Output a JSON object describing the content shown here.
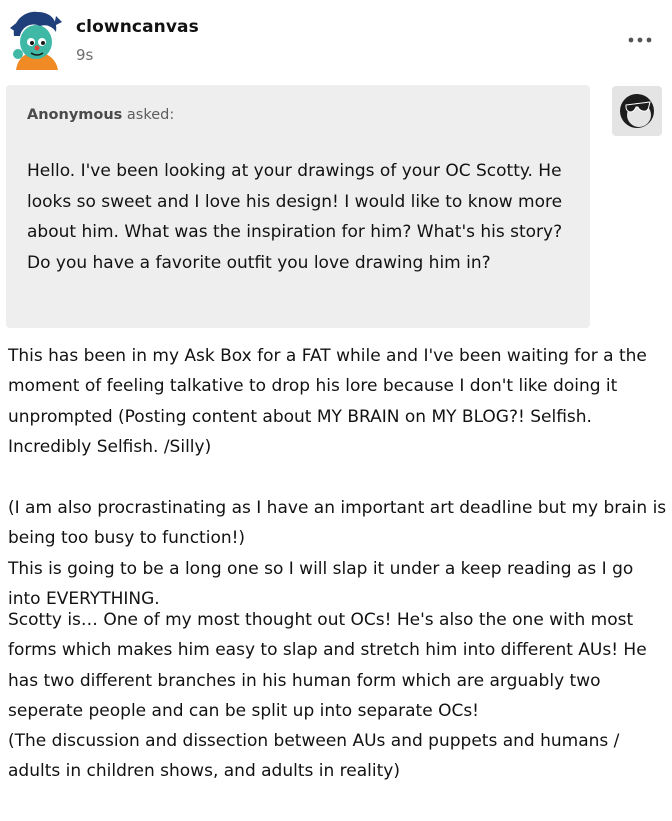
{
  "post": {
    "blog_name": "clowncanvas",
    "timestamp": "9s",
    "more_icon": "ellipsis-icon"
  },
  "ask": {
    "asker_name": "Anonymous",
    "asked_label": " asked:",
    "question": "Hello. I've been looking at your drawings of your OC Scotty. He looks so sweet and I love his design! I would like to know more about him. What was the inspiration for him? What's his story? Do you have a favorite outfit you love drawing him in?",
    "anon_icon": "sunglasses-ghost-icon"
  },
  "answer": {
    "paragraphs": [
      "This has been in my Ask Box for a FAT while and I've been waiting for a the moment of feeling talkative to drop his lore because I don't like doing it unprompted (Posting content about MY BRAIN on MY BLOG?! Selfish. Incredibly Selfish. /Silly)",
      "(I am also procrastinating as I have an important art deadline but my brain is being too busy to function!)",
      "This is going to be a long one so I will slap it under a keep reading as I go into EVERYTHING.",
      "Scotty is… One of my most thought out OCs! He's also the one with most forms which makes him easy to slap and stretch him into different AUs! He has two different branches in his human form which are arguably two seperate people and can be split up into separate OCs!",
      "(The discussion and dissection between AUs and puppets and humans / adults in children shows, and adults in reality)"
    ]
  },
  "colors": {
    "ask_background": "#eeeeee",
    "secondary_text": "#6e6e6e",
    "avatar_skin": "#3fb8a6",
    "avatar_hair": "#1f3f7a",
    "avatar_orange": "#f08a24"
  }
}
